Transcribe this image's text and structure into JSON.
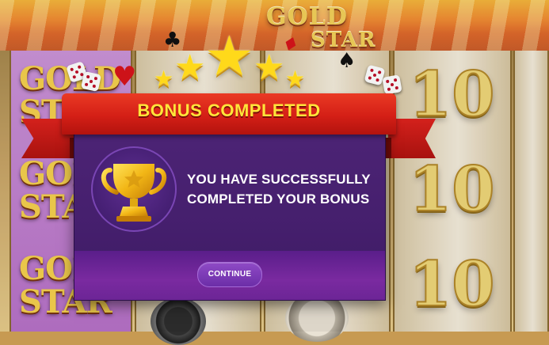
{
  "game": {
    "logo_line1": "GOLD",
    "logo_line2": "STAR"
  },
  "reels": {
    "gold_star_symbol": {
      "line1": "GOLD",
      "line2": "STAR"
    },
    "ten_symbol": "10"
  },
  "popup": {
    "title": "BONUS COMPLETED",
    "message": "YOU HAVE SUCCESSFULLY COMPLETED YOUR BONUS",
    "continue_label": "CONTINUE",
    "star_count": 5
  },
  "colors": {
    "ribbon_red": "#d41f16",
    "title_yellow": "#ffe53a",
    "panel_purple": "#4d2476",
    "button_purple": "#7a36b5",
    "trophy_gold": "#f2b616"
  },
  "icons": [
    "trophy-icon",
    "star-icon",
    "dice-icon",
    "heart-suit-icon",
    "club-suit-icon",
    "spade-suit-icon",
    "diamond-suit-icon"
  ]
}
